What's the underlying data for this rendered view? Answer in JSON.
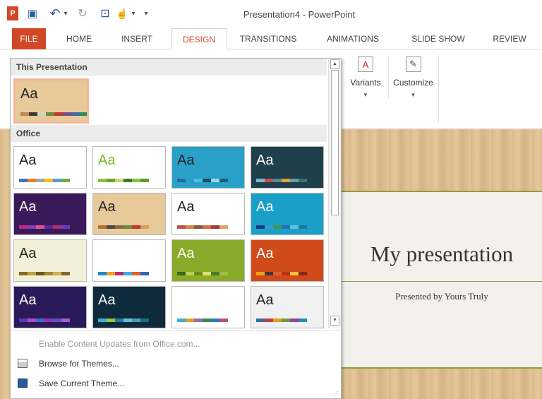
{
  "window": {
    "title": "Presentation4 - PowerPoint"
  },
  "qat": [
    {
      "icon": "powerpoint-logo-icon",
      "glyph": "P"
    },
    {
      "icon": "save-icon",
      "glyph": "▣"
    },
    {
      "icon": "undo-icon",
      "glyph": "↶"
    },
    {
      "icon": "undo-dropdown-icon",
      "glyph": "▾"
    },
    {
      "icon": "redo-icon",
      "glyph": "↻"
    },
    {
      "icon": "start-from-beginning-icon",
      "glyph": "⊡"
    },
    {
      "icon": "touch-mode-icon",
      "glyph": "☝"
    },
    {
      "icon": "customize-qat-icon",
      "glyph": "▾"
    }
  ],
  "tabs": [
    "FILE",
    "HOME",
    "INSERT",
    "DESIGN",
    "TRANSITIONS",
    "ANIMATIONS",
    "SLIDE SHOW",
    "REVIEW"
  ],
  "active_tab": "DESIGN",
  "ribbon": {
    "variants_label": "Variants",
    "customize_label": "Customize"
  },
  "gallery": {
    "this_presentation_label": "This Presentation",
    "office_label": "Office",
    "thumb_text": "Aa",
    "themes_count": 16,
    "this_presentation_theme": {
      "colors": [
        "#c28a4b",
        "#3a3a3a",
        "#d9d0b8",
        "#6b8b3a",
        "#c0392b",
        "#7a4a8a",
        "#3a6ea5",
        "#2e8b57"
      ]
    },
    "office_themes": [
      {
        "bg": "#ffffff",
        "text": "#222",
        "colors": [
          "#4472c4",
          "#ed7d31",
          "#a5a5a5",
          "#ffc000",
          "#5b9bd5",
          "#70ad47"
        ]
      },
      {
        "bg": "#ffffff",
        "text": "#7ab829",
        "colors": [
          "#93c13a",
          "#6ba528",
          "#c8d96f",
          "#3a7a2a",
          "#8bc34a",
          "#5aa02c"
        ]
      },
      {
        "bg": "#2aa0c8",
        "text": "#222",
        "colors": [
          "#1c6e9e",
          "#2aa0c8",
          "#4ac0e0",
          "#1b4f6a",
          "#9bd5e8",
          "#17607a"
        ]
      },
      {
        "bg": "#1f3f4a",
        "text": "#ffffff",
        "colors": [
          "#7ab9c8",
          "#c05050",
          "#4f8a96",
          "#e0a040",
          "#6a9aa4",
          "#3a6f7a"
        ]
      },
      {
        "bg": "#3a1a5a",
        "text": "#ffffff",
        "colors": [
          "#c0288a",
          "#8a3ab8",
          "#e050a0",
          "#5a2a9a",
          "#b03070",
          "#6a40c0"
        ]
      },
      {
        "bg": "#e8c99a",
        "text": "#222",
        "colors": [
          "#b07030",
          "#4a4a4a",
          "#8a6a40",
          "#6b8b3a",
          "#c0392b",
          "#d0a060"
        ]
      },
      {
        "bg": "#ffffff",
        "text": "#222",
        "colors": [
          "#c0504d",
          "#c98a4a",
          "#8a5a3a",
          "#d07040",
          "#a04030",
          "#e0a070"
        ]
      },
      {
        "bg": "#1aa0c8",
        "text": "#ffffff",
        "colors": [
          "#1a3a8a",
          "#2aa0c8",
          "#3a9a4a",
          "#2a6aba",
          "#60c0e0",
          "#1a7a9a"
        ]
      },
      {
        "bg": "#f2f0d8",
        "text": "#222",
        "colors": [
          "#8a6a20",
          "#c0a040",
          "#6a5a20",
          "#a08a30",
          "#d0b050",
          "#7a6a30"
        ]
      },
      {
        "bg": "#ffffff",
        "text": "#ffffff",
        "colors": [
          "#1a8ad8",
          "#f0a020",
          "#c02a6a",
          "#3ab0e0",
          "#e06030",
          "#2a6aba"
        ]
      },
      {
        "bg": "#8aaa2a",
        "text": "#ffffff",
        "colors": [
          "#3a6a1a",
          "#c0d050",
          "#6a8a20",
          "#e0e070",
          "#4a7a2a",
          "#a0c040"
        ]
      },
      {
        "bg": "#d04a1a",
        "text": "#ffffff",
        "colors": [
          "#f0a020",
          "#3a3a3a",
          "#e06030",
          "#c03010",
          "#f0c040",
          "#8a2a10"
        ]
      },
      {
        "bg": "#2a1a5a",
        "text": "#ffffff",
        "colors": [
          "#5a3ab8",
          "#b04ac0",
          "#3a6ad0",
          "#8a3aa0",
          "#6050c8",
          "#a060d0"
        ]
      },
      {
        "bg": "#0f2a3a",
        "text": "#ffffff",
        "colors": [
          "#3ab0d0",
          "#a0c040",
          "#2a7a9a",
          "#60c0e0",
          "#4a9ab0",
          "#1a6a8a"
        ]
      },
      {
        "bg": "#ffffff",
        "text": "#ffffff",
        "colors": [
          "#40b0c8",
          "#e0a020",
          "#9a6ab8",
          "#3a8a4a",
          "#2a7ab8",
          "#c05080"
        ]
      },
      {
        "bg": "#f0f0f0",
        "text": "#222",
        "colors": [
          "#3a6aa0",
          "#c04040",
          "#e0a020",
          "#6a9a3a",
          "#8a4aa0",
          "#2a8ab0"
        ]
      }
    ]
  },
  "menu": [
    {
      "label": "Enable Content Updates from Office.com...",
      "icon": "",
      "enabled": false
    },
    {
      "label": "Browse for Themes...",
      "icon": "browse-themes-icon",
      "enabled": true
    },
    {
      "label": "Save Current Theme...",
      "icon": "save-theme-icon",
      "enabled": true
    }
  ],
  "slide": {
    "title": "My presentation",
    "subtitle": "Presented by Yours Truly"
  }
}
